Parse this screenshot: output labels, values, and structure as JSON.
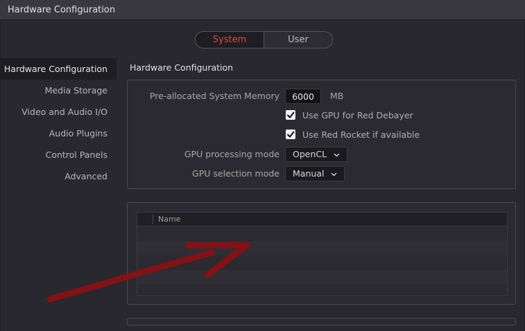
{
  "window": {
    "title": "Hardware Configuration"
  },
  "tabs": [
    {
      "label": "System",
      "active": true
    },
    {
      "label": "User",
      "active": false
    }
  ],
  "sidebar": {
    "items": [
      {
        "label": "Hardware Configuration",
        "active": true
      },
      {
        "label": "Media Storage",
        "active": false
      },
      {
        "label": "Video and Audio I/O",
        "active": false
      },
      {
        "label": "Audio Plugins",
        "active": false
      },
      {
        "label": "Control Panels",
        "active": false
      },
      {
        "label": "Advanced",
        "active": false
      }
    ]
  },
  "section": {
    "title": "Hardware Configuration"
  },
  "settings": {
    "memory": {
      "label": "Pre-allocated System Memory",
      "value": "6000",
      "unit": "MB"
    },
    "gpu_red_debayer": {
      "label": "Use GPU for Red Debayer",
      "checked": true
    },
    "red_rocket": {
      "label": "Use Red Rocket if available",
      "checked": true
    },
    "gpu_processing": {
      "label": "GPU processing mode",
      "value": "OpenCL"
    },
    "gpu_selection": {
      "label": "GPU selection mode",
      "value": "Manual"
    }
  },
  "gpu_list": {
    "columns": [
      "Name"
    ],
    "rows": []
  },
  "colors": {
    "accent": "#e2473b",
    "background": "#28282e",
    "annotation_arrow": "#8b0f14"
  },
  "icons": {
    "checkbox": "checkmark-icon",
    "dropdown": "chevron-down-icon"
  }
}
